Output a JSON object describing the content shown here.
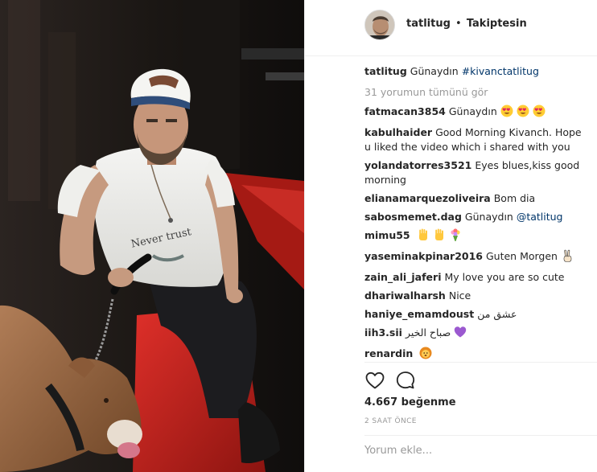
{
  "post": {
    "username": "tatlitug",
    "separator": "•",
    "follow_status": "Takiptesin",
    "caption": {
      "username": "tatlitug",
      "text": "Günaydın ",
      "hashtag": "#kivanctatlitug"
    },
    "view_all_comments": "31 yorumun tümünü gör",
    "comments": [
      {
        "username": "fatmacan3854",
        "text": "Günaydın",
        "emoji": [
          "heart-eyes",
          "heart-eyes",
          "heart-eyes"
        ]
      },
      {
        "username": "kabulhaider",
        "text": "Good Morning Kivanch. Hope u liked the video which i shared with you"
      },
      {
        "username": "yolandatorres3521",
        "text": "Eyes blues,kiss good morning"
      },
      {
        "username": "elianamarquezoliveira",
        "text": "Bom dia"
      },
      {
        "username": "sabosmemet.dag",
        "text": "Günaydın ",
        "mention": "@tatlitug"
      },
      {
        "username": "mimu55",
        "text": "",
        "emoji": [
          "raised-hand",
          "raised-hand",
          "bouquet"
        ]
      },
      {
        "username": "yaseminakpinar2016",
        "text": "Guten Morgen",
        "emoji": [
          "victory-hand"
        ]
      },
      {
        "username": "zain_ali_jaferi",
        "text": "My love you are so cute"
      },
      {
        "username": "dhariwalharsh",
        "text": "Nice"
      },
      {
        "username": "haniye_emamdoust",
        "text": "عشق من"
      },
      {
        "username": "iih3.sii",
        "text": "صباح الخير",
        "emoji": [
          "purple-heart"
        ]
      },
      {
        "username": "renardin",
        "text": "",
        "emoji": [
          "lion"
        ]
      }
    ],
    "like_icon": "heart-outline-icon",
    "comment_icon": "speech-bubble-icon",
    "likes_count": "4.667",
    "likes_label": "beğenme",
    "timestamp": "2 SAAT ÖNCE",
    "comment_placeholder": "Yorum ekle...",
    "colors": {
      "link": "#003569",
      "muted": "#999999",
      "text": "#262626",
      "border": "#efefef"
    }
  }
}
